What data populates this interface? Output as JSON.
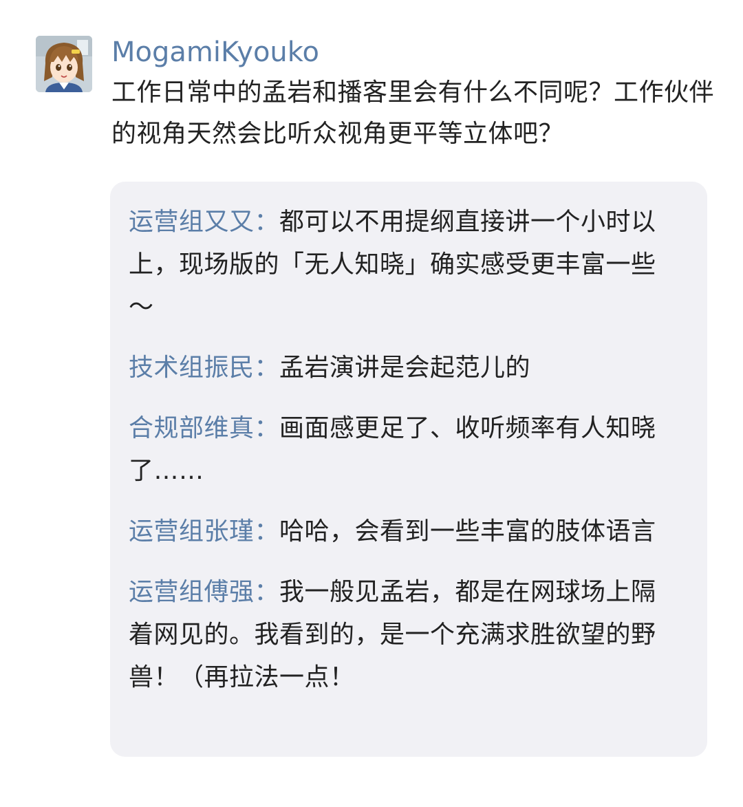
{
  "comment": {
    "username": "MogamiKyouko",
    "avatar_icon": "anime-girl-avatar-icon",
    "text": "工作日常中的孟岩和播客里会有什么不同呢？工作伙伴的视角天然会比听众视角更平等立体吧？"
  },
  "replies": [
    {
      "author": "运营组又又：",
      "text": "都可以不用提纲直接讲一个小时以上，现场版的「无人知晓」确实感受更丰富一些～"
    },
    {
      "author": "技术组振民：",
      "text": "孟岩演讲是会起范儿的"
    },
    {
      "author": "合规部维真：",
      "text": "画面感更足了、收听频率有人知晓了……"
    },
    {
      "author": "运营组张瑾：",
      "text": "哈哈，会看到一些丰富的肢体语言"
    },
    {
      "author": "运营组傅强：",
      "text": "我一般见孟岩，都是在网球场上隔着网见的。我看到的，是一个充满求胜欲望的野兽！（再拉法一点！"
    }
  ],
  "colors": {
    "author": "#5b7ea8",
    "text": "#222222",
    "quote_background": "#f1f1f5"
  }
}
